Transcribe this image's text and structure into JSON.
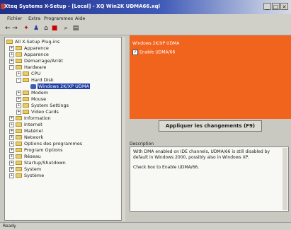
{
  "window": {
    "title": "Xteq Systems X-Setup - [Local] - XQ Win2K UDMA66.xql",
    "min": "_",
    "max": "□",
    "close": "×"
  },
  "menu": [
    "Fichier",
    "Extra",
    "Programmes",
    "Aide"
  ],
  "toolbar_icons": [
    "back-icon",
    "forward-icon",
    "wizard-icon",
    "user-icon",
    "home-icon",
    "record-icon",
    "search-icon",
    "properties-icon"
  ],
  "tree": {
    "root": "All X-Setup Plug-ins",
    "items": [
      {
        "label": "Apparence",
        "expander": "+"
      },
      {
        "label": "Apparence",
        "expander": "+"
      },
      {
        "label": "Démarrage/Arrêt",
        "expander": "+"
      },
      {
        "label": "Hardware",
        "expander": "-"
      },
      {
        "label": "CPU",
        "expander": "+"
      },
      {
        "label": "Hard Disk",
        "expander": "-"
      },
      {
        "label": "Windows 2K/XP UDMA",
        "selected": true
      },
      {
        "label": "Modem",
        "expander": "+"
      },
      {
        "label": "Mouse",
        "expander": "+"
      },
      {
        "label": "System Settings",
        "expander": "+"
      },
      {
        "label": "Video Cards",
        "expander": "+"
      },
      {
        "label": "Information",
        "expander": "+"
      },
      {
        "label": "Internet",
        "expander": "+"
      },
      {
        "label": "Matériel",
        "expander": "+"
      },
      {
        "label": "Network",
        "expander": "+"
      },
      {
        "label": "Options des programmes",
        "expander": "+"
      },
      {
        "label": "Program Options",
        "expander": "+"
      },
      {
        "label": "Réseau",
        "expander": "+"
      },
      {
        "label": "Startup/Shutdown",
        "expander": "+"
      },
      {
        "label": "System",
        "expander": "+"
      },
      {
        "label": "Système",
        "expander": "+"
      }
    ]
  },
  "panel": {
    "header": "Windows 2K/XP UDMA",
    "checkbox_label": "Enable UDMA/66",
    "checkbox_checked": "✓",
    "apply_button": "Appliquer les changements (F9)",
    "description_label": "Description",
    "description_p1": "With DMA enabled on IDE channels, UDMA/66 is still disabled by default in Windows 2000, possibly also in Windows XP.",
    "description_p2": "Check box to Enable UDMA/66."
  },
  "status": "Ready"
}
